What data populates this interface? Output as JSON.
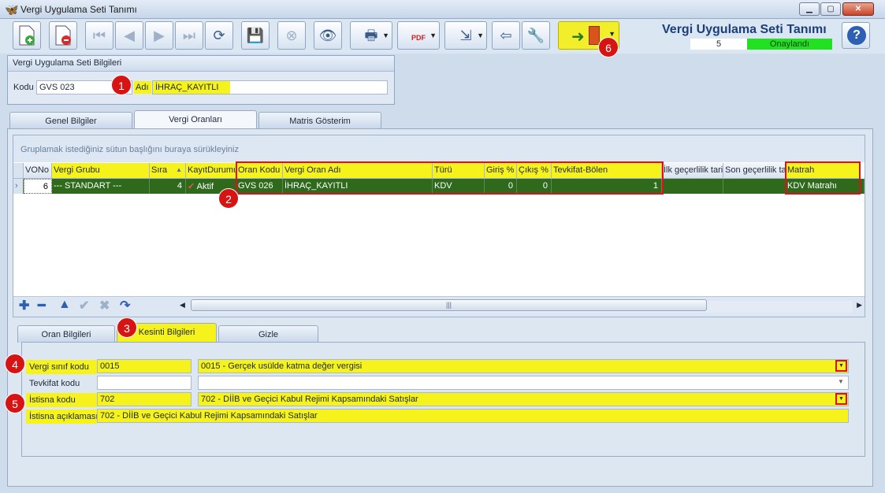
{
  "window": {
    "title": "Vergi Uygulama Seti Tanımı",
    "icon": "butterfly-icon",
    "minimize": "▁",
    "maximize": "▢",
    "close": "✕"
  },
  "toolbar": {
    "buttons": [
      "new-document-icon",
      "delete-document-icon",
      "first-record-icon",
      "previous-record-icon",
      "next-record-icon",
      "last-record-icon",
      "refresh-icon",
      "save-icon",
      "cancel-save-icon",
      "preview-icon",
      "print-icon",
      "pdf-export-icon",
      "export-icon",
      "import-icon",
      "tools-icon"
    ],
    "exit_icon": "exit-door-icon"
  },
  "header": {
    "title": "Vergi Uygulama Seti Tanımı",
    "number": "5",
    "status": "Onaylandı",
    "status_color": "#22e022"
  },
  "info": {
    "group_title": "Vergi Uygulama Seti Bilgileri",
    "kod_label": "Kodu",
    "kod_value": "GVS 023",
    "adi_label": "Adı",
    "adi_value": "İHRAÇ_KAYITLI"
  },
  "main_tabs": [
    "Genel Bilgiler",
    "Vergi Oranları",
    "Matris Gösterim"
  ],
  "grid": {
    "group_hint": "Gruplamak istediğiniz sütun başlığını buraya sürükleyiniz",
    "columns": [
      "VONo",
      "Vergi Grubu",
      "Sıra",
      "KayıtDurumu",
      "Oran Kodu",
      "Vergi Oran Adı",
      "Türü",
      "Giriş %",
      "Çıkış %",
      "Tevkifat-Bölen",
      "İlk geçerlilik tarihi",
      "Son geçerlilik tarihi",
      "Matrah"
    ],
    "sort_indicator": "▲",
    "row": [
      "6",
      "--- STANDART ---",
      "4",
      "Aktif",
      "GVS 026",
      "İHRAÇ_KAYITLI",
      "KDV",
      "0",
      "0",
      "1",
      "",
      "",
      "KDV Matrahı"
    ],
    "status_check": "✓",
    "row_indicator": "›",
    "scroll_grip": "|||"
  },
  "grid_nav": [
    "add-icon",
    "remove-icon",
    "move-up-icon",
    "confirm-icon",
    "cancel-icon",
    "redo-icon"
  ],
  "sub_tabs": [
    "Oran Bilgileri",
    "Kesinti Bilgileri",
    "Gizle"
  ],
  "kesinti": {
    "vergi_sinif_label": "Vergi sınıf kodu",
    "vergi_sinif_code": "0015",
    "vergi_sinif_desc": "0015 - Gerçek usülde katma değer vergisi",
    "tevkifat_label": "Tevkifat kodu",
    "tevkifat_code": "",
    "tevkifat_desc": "",
    "istisna_label": "İstisna kodu",
    "istisna_code": "702",
    "istisna_desc": "702 - DİİB ve Geçici Kabul Rejimi Kapsamındaki Satışlar",
    "istisna_aciklama_label": "İstisna açıklaması",
    "istisna_aciklama": "702 - DİİB ve Geçici Kabul Rejimi Kapsamındaki Satışlar"
  },
  "annotations": [
    "1",
    "2",
    "3",
    "4",
    "5",
    "6"
  ],
  "colors": {
    "highlight": "#f6f21c",
    "annotation": "#d61414",
    "selected_row": "#2f6a1c"
  }
}
